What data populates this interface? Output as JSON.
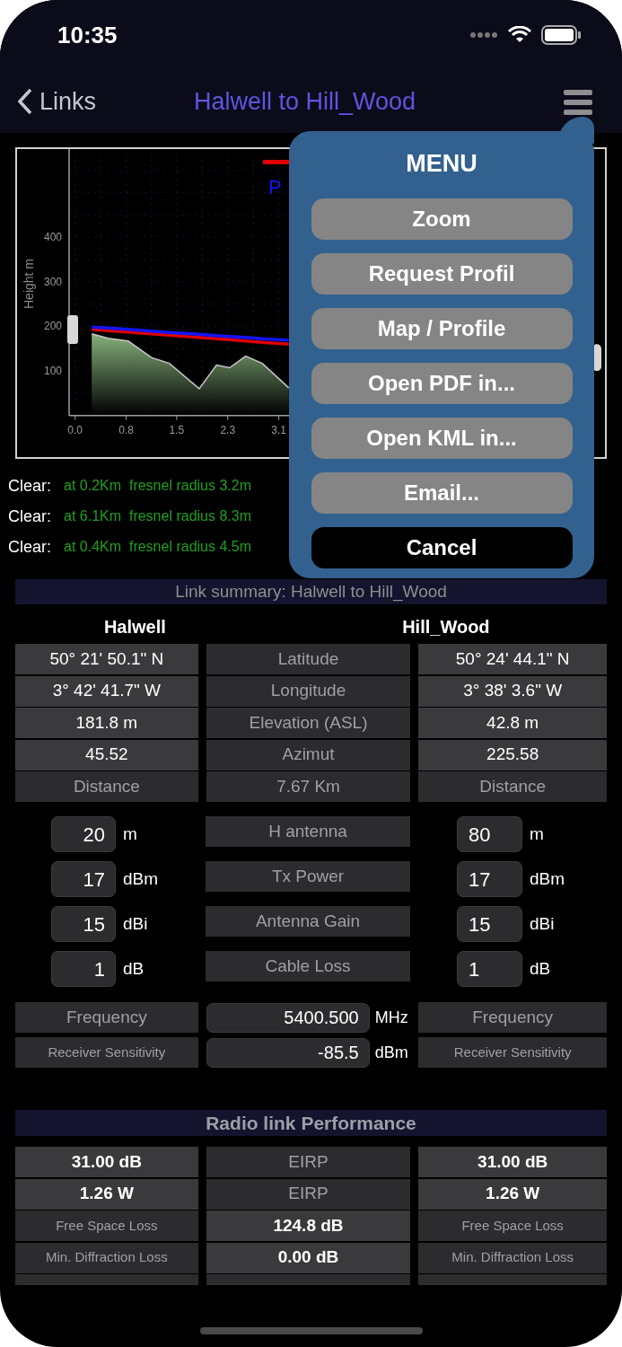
{
  "status_bar": {
    "time": "10:35"
  },
  "nav": {
    "back_label": "Links",
    "title": "Halwell to Hill_Wood"
  },
  "chart": {
    "legend": [
      {
        "color": "#e00000"
      },
      {
        "label": "P",
        "color": "#1414ff"
      }
    ],
    "chart_data": {
      "type": "line",
      "grid": true,
      "ylabel": "Height m",
      "x": [
        0.25,
        0.5,
        0.8,
        1.15,
        1.42,
        1.87,
        2.13,
        2.33,
        2.57,
        2.82,
        3.22
      ],
      "xlim": [
        0,
        7.67
      ],
      "ylim": [
        0,
        590
      ],
      "xticks": [
        {
          "value": 0,
          "label": "0.0"
        },
        {
          "value": 0.77,
          "label": "0.8"
        },
        {
          "value": 1.53,
          "label": "1.5"
        },
        {
          "value": 2.3,
          "label": "2.3"
        },
        {
          "value": 3.07,
          "label": "3.1"
        }
      ],
      "yticks": [
        100,
        200,
        300,
        400
      ],
      "series": [
        {
          "color": "#c8c8c8",
          "values": [
            183,
            173,
            167,
            130,
            117,
            60,
            113,
            107,
            133,
            117,
            62
          ]
        },
        {
          "color": "#e00000",
          "values": [
            193,
            190,
            187,
            183,
            180,
            175,
            172,
            170,
            167,
            164,
            160
          ]
        },
        {
          "color": "#1414ff",
          "values": [
            198,
            196,
            193,
            189,
            186,
            182,
            179,
            177,
            175,
            172,
            169
          ]
        }
      ]
    }
  },
  "clearance": [
    {
      "label": "Clear:",
      "detail": "at 0.2Km  fresnel radius 3.2m"
    },
    {
      "label": "Clear:",
      "detail": "at 6.1Km  fresnel radius 8.3m"
    },
    {
      "label": "Clear:",
      "detail": "at 0.4Km  fresnel radius 4.5m"
    }
  ],
  "menu": {
    "title": "MENU",
    "items": [
      {
        "label": "Zoom",
        "kind": "option"
      },
      {
        "label": "Request Profil",
        "kind": "option"
      },
      {
        "label": "Map / Profile",
        "kind": "option"
      },
      {
        "label": "Open PDF in...",
        "kind": "option"
      },
      {
        "label": "Open KML in...",
        "kind": "option"
      },
      {
        "label": "Email...",
        "kind": "option"
      },
      {
        "label": "Cancel",
        "kind": "cancel"
      }
    ]
  },
  "summary": {
    "title": "Link summary: Halwell to Hill_Wood",
    "left_site": "Halwell",
    "right_site": "Hill_Wood",
    "rows": [
      [
        {
          "text": "50° 21' 50.1\" N",
          "kind": "value"
        },
        {
          "text": "Latitude",
          "kind": "label"
        },
        {
          "text": "50° 24' 44.1\" N",
          "kind": "value"
        }
      ],
      [
        {
          "text": "3° 42' 41.7\" W",
          "kind": "value"
        },
        {
          "text": "Longitude",
          "kind": "label"
        },
        {
          "text": "3° 38' 3.6\" W",
          "kind": "value"
        }
      ],
      [
        {
          "text": "181.8 m",
          "kind": "value"
        },
        {
          "text": "Elevation (ASL)",
          "kind": "label"
        },
        {
          "text": "42.8 m",
          "kind": "value"
        }
      ],
      [
        {
          "text": "45.52",
          "kind": "value"
        },
        {
          "text": "Azimut",
          "kind": "label"
        },
        {
          "text": "225.58",
          "kind": "value"
        }
      ],
      [
        {
          "text": "Distance",
          "kind": "label"
        },
        {
          "text": "7.67 Km",
          "kind": "label"
        },
        {
          "text": "Distance",
          "kind": "label"
        }
      ]
    ]
  },
  "antenna_rows": [
    {
      "left_value": "20",
      "left_unit": "m",
      "label": "H antenna",
      "right_value": "80",
      "right_unit": "m"
    },
    {
      "left_value": "17",
      "left_unit": "dBm",
      "label": "Tx Power",
      "right_value": "17",
      "right_unit": "dBm"
    },
    {
      "left_value": "15",
      "left_unit": "dBi",
      "label": "Antenna Gain",
      "right_value": "15",
      "right_unit": "dBi"
    },
    {
      "left_value": "1",
      "left_unit": "dB",
      "label": "Cable Loss",
      "right_value": "1",
      "right_unit": "dB"
    }
  ],
  "radio_rows": [
    {
      "left_label": "Frequency",
      "value": "5400.500",
      "unit": "MHz",
      "right_label": "Frequency",
      "kind": "label"
    },
    {
      "left_label": "Receiver Sensitivity",
      "value": "-85.5",
      "unit": "dBm",
      "right_label": "Receiver Sensitivity",
      "kind": "small_label"
    }
  ],
  "performance": {
    "title": "Radio link Performance",
    "partial_row": true,
    "rows": [
      [
        {
          "text": "31.00 dB",
          "kind": "bold_value"
        },
        {
          "text": "EIRP",
          "kind": "label"
        },
        {
          "text": "31.00 dB",
          "kind": "bold_value"
        }
      ],
      [
        {
          "text": "1.26 W",
          "kind": "bold_value"
        },
        {
          "text": "EIRP",
          "kind": "label"
        },
        {
          "text": "1.26 W",
          "kind": "bold_value"
        }
      ],
      [
        {
          "text": "Free Space Loss",
          "kind": "small_label"
        },
        {
          "text": "124.8 dB",
          "kind": "bold_value"
        },
        {
          "text": "Free Space Loss",
          "kind": "small_label"
        }
      ],
      [
        {
          "text": "Min. Diffraction Loss",
          "kind": "small_label"
        },
        {
          "text": "0.00 dB",
          "kind": "bold_value"
        },
        {
          "text": "Min. Diffraction Loss",
          "kind": "small_label"
        }
      ]
    ]
  }
}
